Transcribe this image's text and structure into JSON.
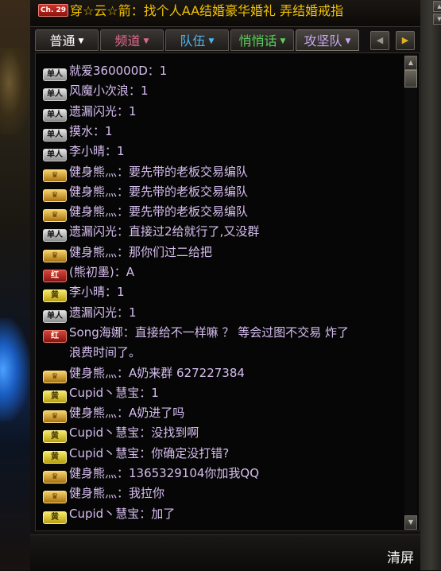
{
  "broadcast": {
    "channel_badge": "Ch. 29",
    "text": "穿☆云☆箭：找个人AA结婚豪华婚礼 弄结婚戒指"
  },
  "tabs": [
    {
      "label": "普通",
      "color": "#ffffff"
    },
    {
      "label": "频道",
      "color": "#e06a8a"
    },
    {
      "label": "队伍",
      "color": "#4fb4f0"
    },
    {
      "label": "悄悄话",
      "color": "#5ad05a"
    },
    {
      "label": "攻坚队",
      "color": "#c8a8f0"
    }
  ],
  "badge_labels": {
    "single": "单人",
    "huang": "黄",
    "hong": "红"
  },
  "messages": [
    {
      "badge": "single",
      "text": "就爱360000D：1"
    },
    {
      "badge": "single",
      "text": "风魔小次浪：1"
    },
    {
      "badge": "single",
      "text": "遗漏闪光：1"
    },
    {
      "badge": "single",
      "text": "摸水：1"
    },
    {
      "badge": "single",
      "text": "李小晴：1"
    },
    {
      "badge": "crown",
      "text": "健身熊灬：要先带的老板交易编队"
    },
    {
      "badge": "crown",
      "text": "健身熊灬：要先带的老板交易编队"
    },
    {
      "badge": "crown",
      "text": "健身熊灬：要先带的老板交易编队"
    },
    {
      "badge": "single",
      "text": "遗漏闪光：直接过2给就行了,又没群"
    },
    {
      "badge": "crown",
      "text": "健身熊灬：那你们过二给把"
    },
    {
      "badge": "hong",
      "text": "(熊初墨)：A"
    },
    {
      "badge": "huang",
      "text": "李小晴：1"
    },
    {
      "badge": "single",
      "text": "遗漏闪光：1"
    },
    {
      "badge": "hong",
      "text": "Song海娜：直接给不一样嘛 ？ 等会过图不交易 炸了"
    },
    {
      "badge": "",
      "text": "浪费时间了。"
    },
    {
      "badge": "crown",
      "text": "健身熊灬：A奶来群 627227384"
    },
    {
      "badge": "huang",
      "text": "Cupid丶慧宝：1"
    },
    {
      "badge": "crown",
      "text": "健身熊灬：A奶进了吗"
    },
    {
      "badge": "huang",
      "text": "Cupid丶慧宝：没找到啊"
    },
    {
      "badge": "huang",
      "text": "Cupid丶慧宝：你确定没打错?"
    },
    {
      "badge": "crown",
      "text": "健身熊灬：1365329104你加我QQ"
    },
    {
      "badge": "crown",
      "text": "健身熊灬：我拉你"
    },
    {
      "badge": "huang",
      "text": "Cupid丶慧宝：加了"
    }
  ],
  "footer": {
    "clear_label": "清屏"
  }
}
